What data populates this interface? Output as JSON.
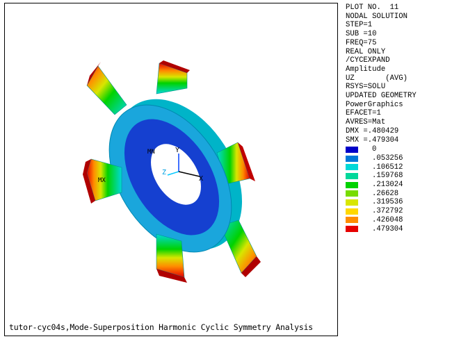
{
  "info_lines": [
    "PLOT NO.  11",
    "NODAL SOLUTION",
    "STEP=1",
    "SUB =10",
    "FREQ=75",
    "REAL ONLY",
    "/CYCEXPAND",
    "Amplitude",
    "UZ       (AVG)",
    "RSYS=SOLU",
    "UPDATED GEOMETRY",
    "PowerGraphics",
    "EFACET=1",
    "AVRES=Mat",
    "DMX =.480429",
    "SMX =.479304"
  ],
  "legend": [
    {
      "value": "0",
      "color": "#0000c8"
    },
    {
      "value": ".053256",
      "color": "#0078d8"
    },
    {
      "value": ".106512",
      "color": "#00d8d8"
    },
    {
      "value": ".159768",
      "color": "#00d89a"
    },
    {
      "value": ".213024",
      "color": "#00d200"
    },
    {
      "value": ".26628",
      "color": "#78dc00"
    },
    {
      "value": ".319536",
      "color": "#d8e600"
    },
    {
      "value": ".372792",
      "color": "#ffd800"
    },
    {
      "value": ".426048",
      "color": "#ff8c00"
    },
    {
      "value": ".479304",
      "color": "#e60000"
    }
  ],
  "caption": "tutor-cyc04s,Mode-Superposition Harmonic Cyclic Symmetry Analysis",
  "axes": {
    "y": "Y",
    "z": "Z",
    "x": "X"
  },
  "marker": "MX"
}
